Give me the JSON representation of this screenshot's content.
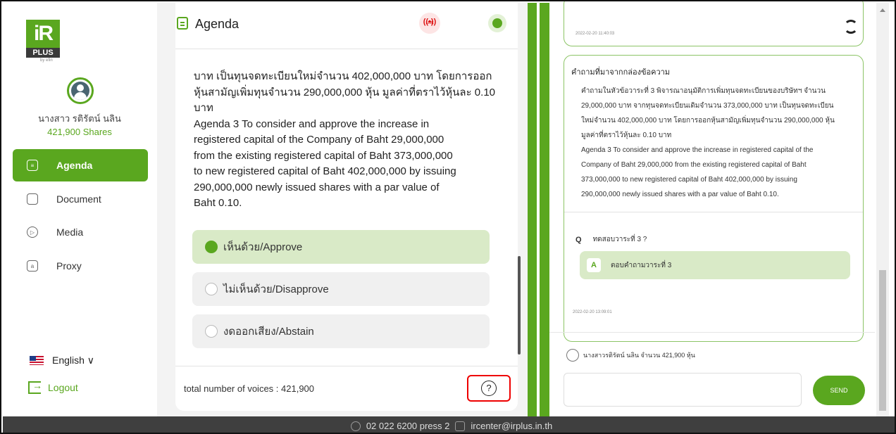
{
  "sidebar": {
    "logo": "iR PLUS",
    "logo_by": "by efin",
    "user_name": "นางสาว รติรัตน์ นลิน",
    "user_shares": "421,900 Shares",
    "items": [
      {
        "label": "Agenda",
        "icon": "agenda-icon",
        "active": true
      },
      {
        "label": "Document",
        "icon": "folder-icon",
        "active": false
      },
      {
        "label": "Media",
        "icon": "play-icon",
        "active": false
      },
      {
        "label": "Proxy",
        "icon": "proxy-icon",
        "active": false
      }
    ],
    "language": "English ∨",
    "logout": "Logout"
  },
  "agenda": {
    "title": "Agenda",
    "live_label": "LIVE",
    "body": "บาท เป็นทุนจดทะเบียนใหม่จำนวน 402,000,000 บาท โดยการออก\nหุ้นสามัญเพิ่มทุนจำนวน 290,000,000 หุ้น มูลค่าที่ตราไว้หุ้นละ 0.10\nบาท\nAgenda 3 To consider and approve the increase in\nregistered capital of the Company of Baht 29,000,000\nfrom the existing registered capital of Baht 373,000,000\nto new registered capital of Baht 402,000,000 by issuing\n290,000,000 newly issued shares with a par value of\nBaht 0.10.",
    "options": [
      {
        "label": "เห็นด้วย/Approve",
        "selected": true
      },
      {
        "label": "ไม่เห็นด้วย/Disapprove",
        "selected": false
      },
      {
        "label": "งดออกเสียง/Abstain",
        "selected": false
      }
    ],
    "total_voices": "total number of voices : 421,900",
    "help_icon": "?"
  },
  "chat": {
    "card1_timestamp": "2022-02-20 11:40:03",
    "heading": "คำถามที่มาจากกล่องข้อความ",
    "quote": "คำถามในหัวข้อวาระที่ 3 พิจารณาอนุมัติการเพิ่มทุนจดทะเบียนของบริษัทฯ จำนวน\n29,000,000 บาท จากทุนจดทะเบียนเดิมจำนวน 373,000,000 บาท เป็นทุนจดทะเบียน\nใหม่จำนวน 402,000,000 บาท โดยการออกหุ้นสามัญเพิ่มทุนจำนวน 290,000,000 หุ้น\nมูลค่าที่ตราไว้หุ้นละ 0.10 บาท\nAgenda 3 To consider and approve the increase in registered capital of the\nCompany of Baht 29,000,000 from the existing registered capital of Baht\n373,000,000 to new registered capital of Baht 402,000,000 by issuing\n290,000,000 newly issued shares with a par value of Baht 0.10.",
    "question_label": "Q",
    "question_text": "ทดสอบวาระที่ 3 ?",
    "answer_label": "A",
    "answer_text": "ตอบคำถามวาระที่ 3",
    "card2_timestamp": "2022-02-20 13:09:01",
    "sender": "นางสาวรติรัตน์ นลิน จำนวน 421,900 หุ้น",
    "input_value": "",
    "send_label": "SEND"
  },
  "footer": {
    "phone": "02 022 6200 press 2",
    "email": "ircenter@irplus.in.th"
  },
  "colors": {
    "accent": "#5aa71f",
    "selected_option": "#d9eac7",
    "footer_bg": "#3f3f3f",
    "highlight_border": "#ee0000"
  }
}
